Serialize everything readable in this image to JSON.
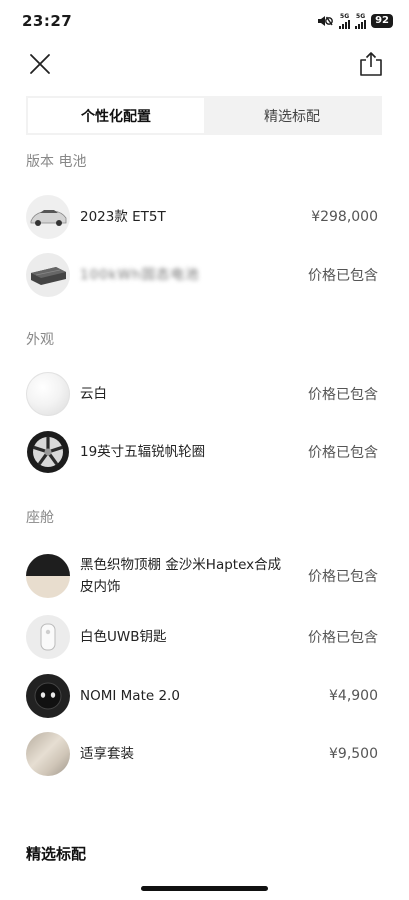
{
  "status_bar": {
    "time": "23:27",
    "network_1": "5G",
    "network_2": "5G",
    "battery": "92"
  },
  "tabs": [
    {
      "label": "个性化配置",
      "active": true
    },
    {
      "label": "精选标配",
      "active": false
    }
  ],
  "sections": {
    "version_battery": {
      "title": "版本 电池",
      "items": [
        {
          "name": "2023款 ET5T",
          "price": "¥298,000",
          "thumb": "car-thumbnail"
        },
        {
          "name": "100kWh固态电池",
          "price": "价格已包含",
          "thumb": "battery-thumbnail",
          "obscured": true
        }
      ]
    },
    "exterior": {
      "title": "外观",
      "items": [
        {
          "name": "云白",
          "price": "价格已包含",
          "thumb": "white-paint-swatch"
        },
        {
          "name": "19英寸五辐锐帆轮圈",
          "price": "价格已包含",
          "thumb": "wheel-thumbnail"
        }
      ]
    },
    "cabin": {
      "title": "座舱",
      "items": [
        {
          "name": "黑色织物顶棚 金沙米Haptex合成皮内饰",
          "price": "价格已包含",
          "thumb": "interior-swatch"
        },
        {
          "name": "白色UWB钥匙",
          "price": "价格已包含",
          "thumb": "key-thumbnail"
        },
        {
          "name": "NOMI Mate 2.0",
          "price": "¥4,900",
          "thumb": "nomi-thumbnail"
        },
        {
          "name": "适享套装",
          "price": "¥9,500",
          "thumb": "package-thumbnail"
        }
      ]
    }
  },
  "bottom_section_title": "精选标配"
}
